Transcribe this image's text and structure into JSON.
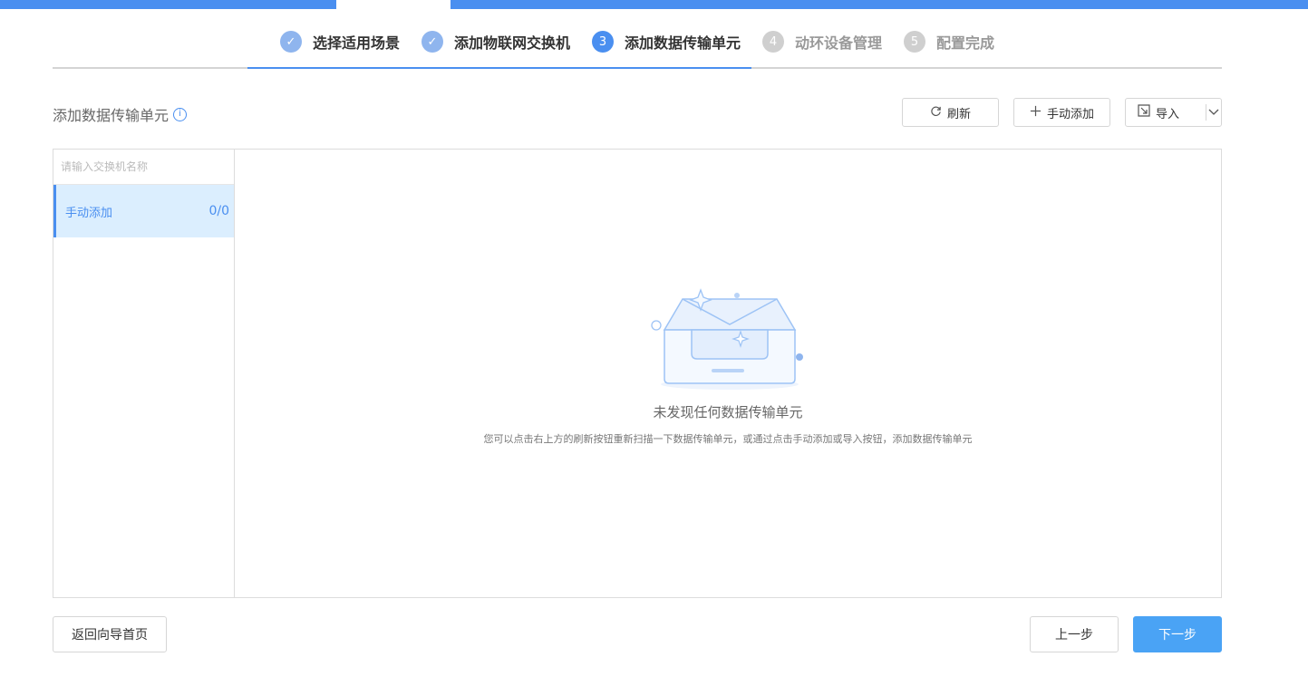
{
  "wizard": {
    "steps": [
      {
        "label": "选择适用场景",
        "state": "done",
        "marker": "✓"
      },
      {
        "label": "添加物联网交换机",
        "state": "done",
        "marker": "✓"
      },
      {
        "label": "添加数据传输单元",
        "state": "current",
        "marker": "3"
      },
      {
        "label": "动环设备管理",
        "state": "todo",
        "marker": "4"
      },
      {
        "label": "配置完成",
        "state": "todo",
        "marker": "5"
      }
    ]
  },
  "section": {
    "title": "添加数据传输单元",
    "info_icon": "info-icon"
  },
  "toolbar": {
    "refresh_label": "刷新",
    "manual_add_label": "手动添加",
    "import_label": "导入"
  },
  "sidebar": {
    "search_placeholder": "请输入交换机名称",
    "items": [
      {
        "label": "手动添加",
        "count": "0/0"
      }
    ]
  },
  "empty_state": {
    "title": "未发现任何数据传输单元",
    "description": "您可以点击右上方的刷新按钮重新扫描一下数据传输单元，或通过点击手动添加或导入按钮，添加数据传输单元"
  },
  "footer": {
    "back_home_label": "返回向导首页",
    "prev_label": "上一步",
    "next_label": "下一步"
  },
  "colors": {
    "accent": "#4a8ff0",
    "primary_button": "#4aa3f5",
    "selected_bg": "#dbeefe"
  }
}
